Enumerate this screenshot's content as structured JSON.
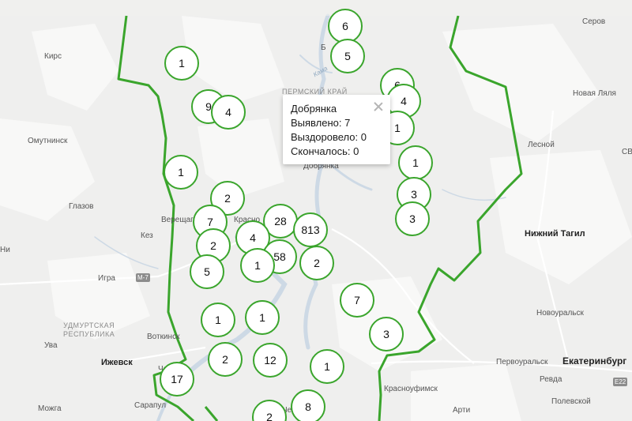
{
  "colors": {
    "border": "#3aa52c",
    "cluster_fill": "#ffffff",
    "water": "#cdd9e5",
    "land": "#f0f0ef"
  },
  "places": [
    {
      "id": "kirs",
      "text": "Кирс"
    },
    {
      "id": "omutninsk",
      "text": "Омутнинск"
    },
    {
      "id": "glazov",
      "text": "Глазов"
    },
    {
      "id": "kez",
      "text": "Кез"
    },
    {
      "id": "igra",
      "text": "Игра"
    },
    {
      "id": "votkinsk",
      "text": "Воткинск"
    },
    {
      "id": "izhevsk",
      "text": "Ижевск"
    },
    {
      "id": "uva",
      "text": "Ува"
    },
    {
      "id": "sarapul",
      "text": "Сарапул"
    },
    {
      "id": "mozhga",
      "text": "Можга"
    },
    {
      "id": "vereshchagino",
      "text": "Верещаги"
    },
    {
      "id": "krasnokamsk",
      "text": "Красно"
    },
    {
      "id": "dobryanka",
      "text": "Добрянка"
    },
    {
      "id": "chaik",
      "text": "Чай"
    },
    {
      "id": "chern",
      "text": "Чер"
    },
    {
      "id": "berez",
      "text": "Б"
    },
    {
      "id": "kama",
      "text": "Кама"
    },
    {
      "id": "permkrai",
      "text": "ПЕРМСКИЙ КРАЙ"
    },
    {
      "id": "serov",
      "text": "Серов"
    },
    {
      "id": "novlyalya",
      "text": "Новая Ляля"
    },
    {
      "id": "lesnoy",
      "text": "Лесной"
    },
    {
      "id": "ntagil",
      "text": "Нижний Тагил"
    },
    {
      "id": "novouralsk",
      "text": "Новоуральск"
    },
    {
      "id": "pervouralsk",
      "text": "Первоуральск"
    },
    {
      "id": "ekb",
      "text": "Екатеринбург"
    },
    {
      "id": "revda",
      "text": "Ревда"
    },
    {
      "id": "polevskoy",
      "text": "Полевской"
    },
    {
      "id": "krasnoufimsk",
      "text": "Красноуфимск"
    },
    {
      "id": "arti",
      "text": "Арти"
    },
    {
      "id": "ni",
      "text": "Ни"
    },
    {
      "id": "sv",
      "text": "СВ"
    },
    {
      "id": "e22",
      "text": "E22"
    }
  ],
  "udmurt_region": "УДМУРТСКАЯ\nРЕСПУБЛИКА",
  "road_m7": "М-7",
  "clusters": [
    {
      "n": "6"
    },
    {
      "n": "5"
    },
    {
      "n": "1"
    },
    {
      "n": "9"
    },
    {
      "n": "4"
    },
    {
      "n": "6"
    },
    {
      "n": "4"
    },
    {
      "n": "1"
    },
    {
      "n": "1"
    },
    {
      "n": "1"
    },
    {
      "n": "3"
    },
    {
      "n": "3"
    },
    {
      "n": "2"
    },
    {
      "n": "7"
    },
    {
      "n": "28"
    },
    {
      "n": "813"
    },
    {
      "n": "2"
    },
    {
      "n": "4"
    },
    {
      "n": "58"
    },
    {
      "n": "1"
    },
    {
      "n": "2"
    },
    {
      "n": "5"
    },
    {
      "n": "7"
    },
    {
      "n": "1"
    },
    {
      "n": "1"
    },
    {
      "n": "3"
    },
    {
      "n": "2"
    },
    {
      "n": "12"
    },
    {
      "n": "1"
    },
    {
      "n": "17"
    },
    {
      "n": "8"
    },
    {
      "n": "2"
    }
  ],
  "popup": {
    "title": "Добрянка",
    "detected": "Выявлено: 7",
    "recovered": "Выздоровело: 0",
    "died": "Скончалось: 0"
  }
}
